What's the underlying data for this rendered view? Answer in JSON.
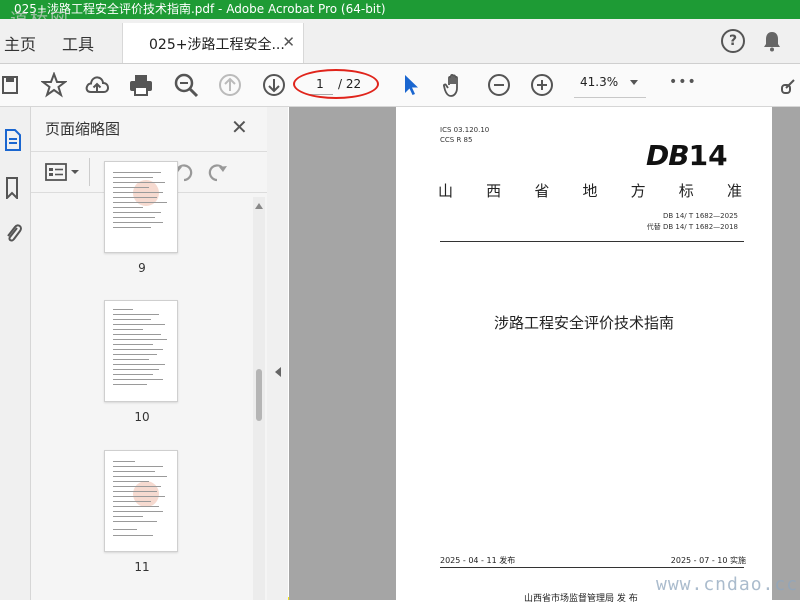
{
  "window": {
    "title": "025+涉路工程安全评价技术指南.pdf - Adobe Acrobat Pro (64-bit)",
    "watermark_top": "道桥网"
  },
  "tabs": {
    "home": "主页",
    "tools": "工具",
    "document": "025+涉路工程安全..."
  },
  "toolbar": {
    "current_page": "1",
    "total_pages": "/ 22",
    "zoom": "41.3%",
    "more": "•••"
  },
  "panel": {
    "title": "页面缩略图",
    "thumbnails": [
      {
        "label": "9"
      },
      {
        "label": "10"
      },
      {
        "label": "11"
      }
    ]
  },
  "document": {
    "ics": "ICS  03.120.10",
    "ccs": "CCS  R 85",
    "logo_db": "DB",
    "logo_num": "14",
    "std_chars": [
      "山",
      "西",
      "省",
      "地",
      "方",
      "标",
      "准"
    ],
    "std_number": "DB 14/ T 1682—2025",
    "replaces": "代替 DB 14/ T 1682—2018",
    "title": "涉路工程安全评价技术指南",
    "issue_date": "2025 - 04 - 11 发布",
    "impl_date": "2025 - 07 - 10 实施",
    "issuer": "山西省市场监督管理局    发 布"
  },
  "watermark_bottom": "www.cndao.cc",
  "colors": {
    "titlebar": "#1e9b35",
    "frame": "#f2e418",
    "accent_blue": "#1a66d0",
    "annotation_red": "#e0241b"
  }
}
